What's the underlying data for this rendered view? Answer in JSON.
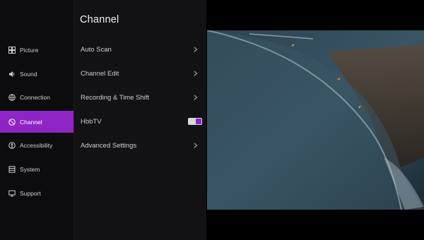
{
  "sidebar": {
    "items": [
      {
        "label": "Picture",
        "icon": "picture-icon",
        "active": false
      },
      {
        "label": "Sound",
        "icon": "sound-icon",
        "active": false
      },
      {
        "label": "Connection",
        "icon": "connection-icon",
        "active": false
      },
      {
        "label": "Channel",
        "icon": "channel-icon",
        "active": true
      },
      {
        "label": "Accessibility",
        "icon": "accessibility-icon",
        "active": false
      },
      {
        "label": "System",
        "icon": "system-icon",
        "active": false
      },
      {
        "label": "Support",
        "icon": "support-icon",
        "active": false
      }
    ]
  },
  "panel": {
    "title": "Channel",
    "items": [
      {
        "label": "Auto Scan",
        "control": "chevron"
      },
      {
        "label": "Channel Edit",
        "control": "chevron"
      },
      {
        "label": "Recording & Time Shift",
        "control": "chevron"
      },
      {
        "label": "HbbTV",
        "control": "toggle",
        "value": true
      },
      {
        "label": "Advanced Settings",
        "control": "chevron"
      }
    ]
  },
  "colors": {
    "accent": "#8f25c5",
    "background": "#000000",
    "panel": "#121214",
    "sidebar": "#0c0c0e"
  }
}
